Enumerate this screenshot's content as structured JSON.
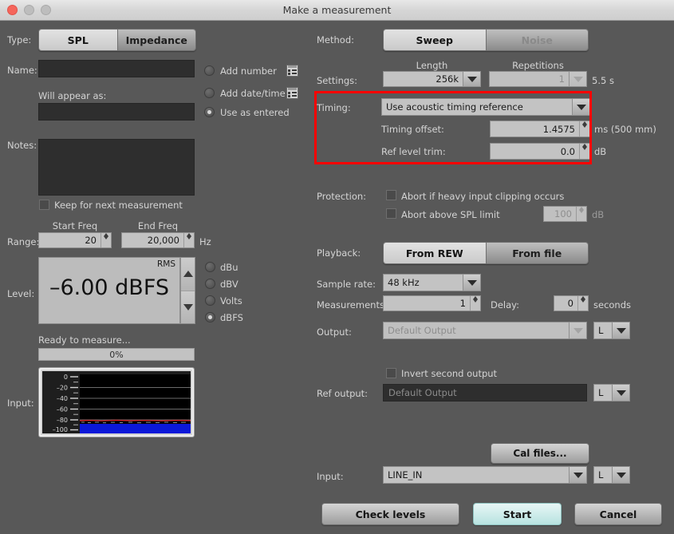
{
  "window": {
    "title": "Make a measurement",
    "controls": {
      "close": "close-button",
      "minimize": "minimize-button",
      "maximize": "maximize-button"
    }
  },
  "left": {
    "type_label": "Type:",
    "type_options": [
      {
        "label": "SPL",
        "selected": true
      },
      {
        "label": "Impedance",
        "selected": false
      }
    ],
    "name_label": "Name:",
    "name_value": "",
    "will_appear_label": "Will appear as:",
    "will_appear_value": "",
    "naming_options": [
      {
        "label": "Add number",
        "selected": false,
        "has_icon": true
      },
      {
        "label": "Add date/time",
        "selected": false,
        "has_icon": true
      },
      {
        "label": "Use as entered",
        "selected": true,
        "has_icon": false
      }
    ],
    "notes_label": "Notes:",
    "notes_value": "",
    "keep_notes_label": "Keep for next measurement",
    "keep_notes_checked": false,
    "range_label": "Range:",
    "start_freq_label": "Start Freq",
    "end_freq_label": "End Freq",
    "start_freq_value": "20",
    "end_freq_value": "20,000",
    "range_unit": "Hz",
    "level_label": "Level:",
    "level_rms": "RMS",
    "level_value": "–6.00 dBFS",
    "level_units": [
      {
        "label": "dBu",
        "selected": false
      },
      {
        "label": "dBV",
        "selected": false
      },
      {
        "label": "Volts",
        "selected": false
      },
      {
        "label": "dBFS",
        "selected": true
      }
    ],
    "status_text": "Ready to measure...",
    "progress_text": "0%",
    "progress_percent": 0,
    "input_label": "Input:",
    "scope_ticks": [
      "0",
      "–20",
      "–40",
      "–60",
      "–80",
      "–100"
    ]
  },
  "right": {
    "method_label": "Method:",
    "method_options": [
      {
        "label": "Sweep",
        "selected": true,
        "enabled": true
      },
      {
        "label": "Noise",
        "selected": false,
        "enabled": false
      }
    ],
    "settings_label": "Settings:",
    "length_label": "Length",
    "length_value": "256k",
    "repetitions_label": "Repetitions",
    "repetitions_value": "1",
    "repetitions_enabled": false,
    "duration_text": "5.5 s",
    "timing_label": "Timing:",
    "timing_mode": "Use acoustic timing reference",
    "timing_offset_label": "Timing offset:",
    "timing_offset_value": "1.4575",
    "timing_offset_unit": "ms (500 mm)",
    "ref_level_trim_label": "Ref level trim:",
    "ref_level_trim_value": "0.0",
    "ref_level_trim_unit": "dB",
    "protection_label": "Protection:",
    "protection_options": [
      {
        "label": "Abort if heavy input clipping occurs",
        "checked": false
      },
      {
        "label": "Abort above SPL limit",
        "checked": false
      }
    ],
    "spl_limit_value": "100",
    "spl_limit_unit": "dB",
    "playback_label": "Playback:",
    "playback_options": [
      {
        "label": "From REW",
        "selected": true
      },
      {
        "label": "From file",
        "selected": false
      }
    ],
    "sample_rate_label": "Sample rate:",
    "sample_rate_value": "48 kHz",
    "measurements_label": "Measurements:",
    "measurements_value": "1",
    "delay_label": "Delay:",
    "delay_value": "0",
    "delay_unit": "seconds",
    "output_label": "Output:",
    "output_value": "Default Output",
    "output_channel": "L",
    "invert_second_output_label": "Invert second output",
    "invert_second_output_checked": false,
    "ref_output_label": "Ref output:",
    "ref_output_value": "Default Output",
    "ref_output_channel": "L",
    "cal_files_label": "Cal files...",
    "input_label": "Input:",
    "input_value": "LINE_IN",
    "input_channel": "L"
  },
  "footer": {
    "check_levels_label": "Check levels",
    "start_label": "Start",
    "cancel_label": "Cancel"
  },
  "highlight": {
    "color": "#ff0000",
    "target": "timing-section"
  }
}
